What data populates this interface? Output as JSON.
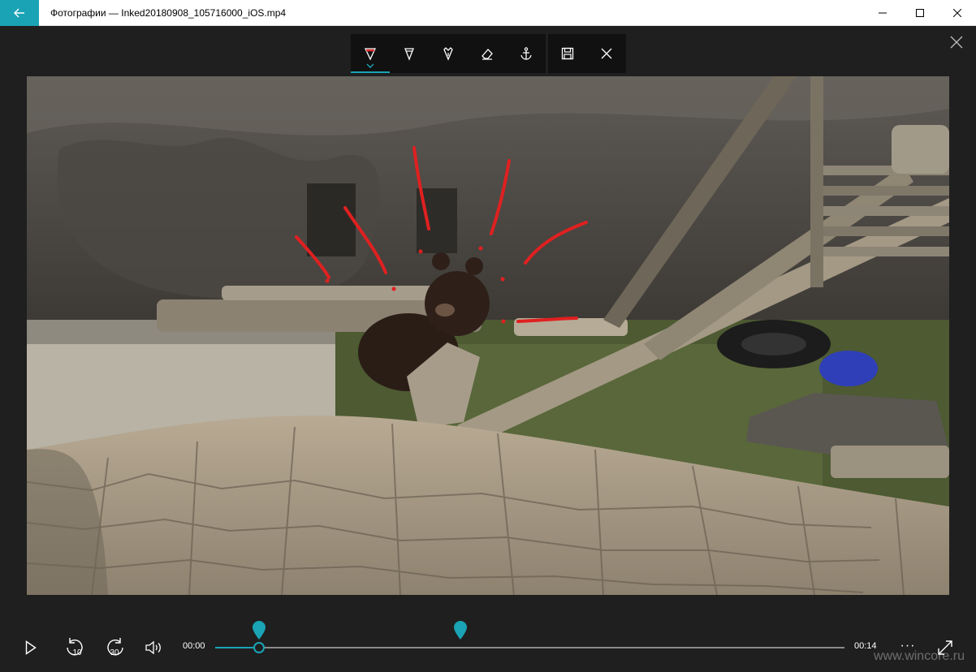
{
  "window": {
    "title": "Фотографии — Inked20180908_105716000_iOS.mp4",
    "accent": "#1aa3b5"
  },
  "ink_toolbar": {
    "tools": [
      {
        "name": "ballpoint-pen",
        "selected": true,
        "ink_color": "#e03030"
      },
      {
        "name": "pencil",
        "selected": false
      },
      {
        "name": "calligraphy-pen",
        "selected": false
      },
      {
        "name": "eraser",
        "selected": false
      },
      {
        "name": "anchor",
        "selected": false
      }
    ],
    "actions": [
      {
        "name": "save"
      },
      {
        "name": "close"
      }
    ]
  },
  "playback": {
    "current_time": "00:00",
    "total_time": "00:14",
    "skip_back_label": "10",
    "skip_forward_label": "30",
    "progress_fraction": 0.07,
    "ink_marker_fraction": 0.39,
    "more_label": "···"
  },
  "watermark": "www.wincore.ru"
}
